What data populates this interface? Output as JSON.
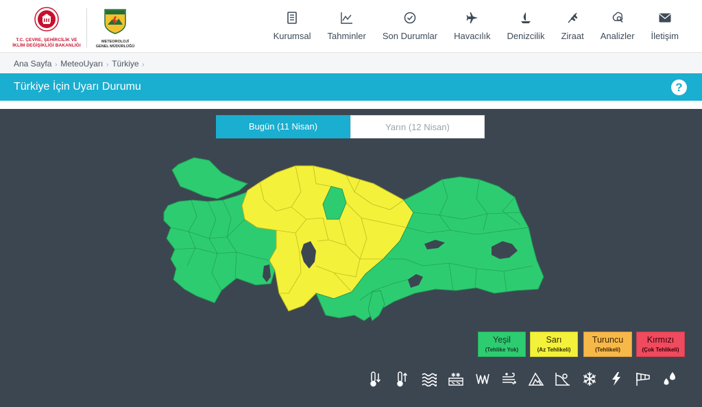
{
  "header": {
    "ministry_line1": "T.C. ÇEVRE, ŞEHİRCİLİK VE",
    "ministry_line2": "İKLİM DEĞİŞİKLİĞİ BAKANLIĞI",
    "mgm_badge": "METEOROLOJİ",
    "mgm_line1": "METEOROLOJİ",
    "mgm_line2": "GENEL MÜDÜRLÜĞÜ"
  },
  "nav": {
    "items": [
      {
        "label": "Kurumsal",
        "icon": "document-icon"
      },
      {
        "label": "Tahminler",
        "icon": "chart-icon"
      },
      {
        "label": "Son Durumlar",
        "icon": "check-circle-icon"
      },
      {
        "label": "Havacılık",
        "icon": "airplane-icon"
      },
      {
        "label": "Denizcilik",
        "icon": "sailboat-icon"
      },
      {
        "label": "Ziraat",
        "icon": "wheat-icon"
      },
      {
        "label": "Analizler",
        "icon": "analysis-icon"
      },
      {
        "label": "İletişim",
        "icon": "envelope-icon"
      }
    ]
  },
  "breadcrumb": {
    "items": [
      "Ana Sayfa",
      "MeteoUyarı",
      "Türkiye"
    ]
  },
  "page": {
    "title": "Türkiye İçin Uyarı Durumu",
    "help": "?"
  },
  "tabs": [
    {
      "label": "Bugün (11 Nisan)",
      "active": true
    },
    {
      "label": "Yarın (12 Nisan)",
      "active": false
    }
  ],
  "legend": [
    {
      "name": "Yeşil",
      "desc": "(Tehlike Yok)",
      "color": "#2ecc71"
    },
    {
      "name": "Sarı",
      "desc": "(Az Tehlikeli)",
      "color": "#f4f13a"
    },
    {
      "name": "Turuncu",
      "desc": "(Tehlikeli)",
      "color": "#f7b84a"
    },
    {
      "name": "Kırmızı",
      "desc": "(Çok Tehlikeli)",
      "color": "#ef4a5e"
    }
  ],
  "colors": {
    "accent": "#1aaed0",
    "map_background": "#3c4651",
    "green": "#2ecc71",
    "yellow": "#f4f13a",
    "lake": "#3c4651"
  },
  "hazards": [
    "cold-thermometer-icon",
    "hot-thermometer-icon",
    "fog-waves-icon",
    "snow-ice-icon",
    "heavy-rain-icon",
    "wind-icon",
    "avalanche-icon",
    "landslide-icon",
    "snowflake-icon",
    "thunderstorm-icon",
    "windsock-icon",
    "rain-drops-icon"
  ]
}
